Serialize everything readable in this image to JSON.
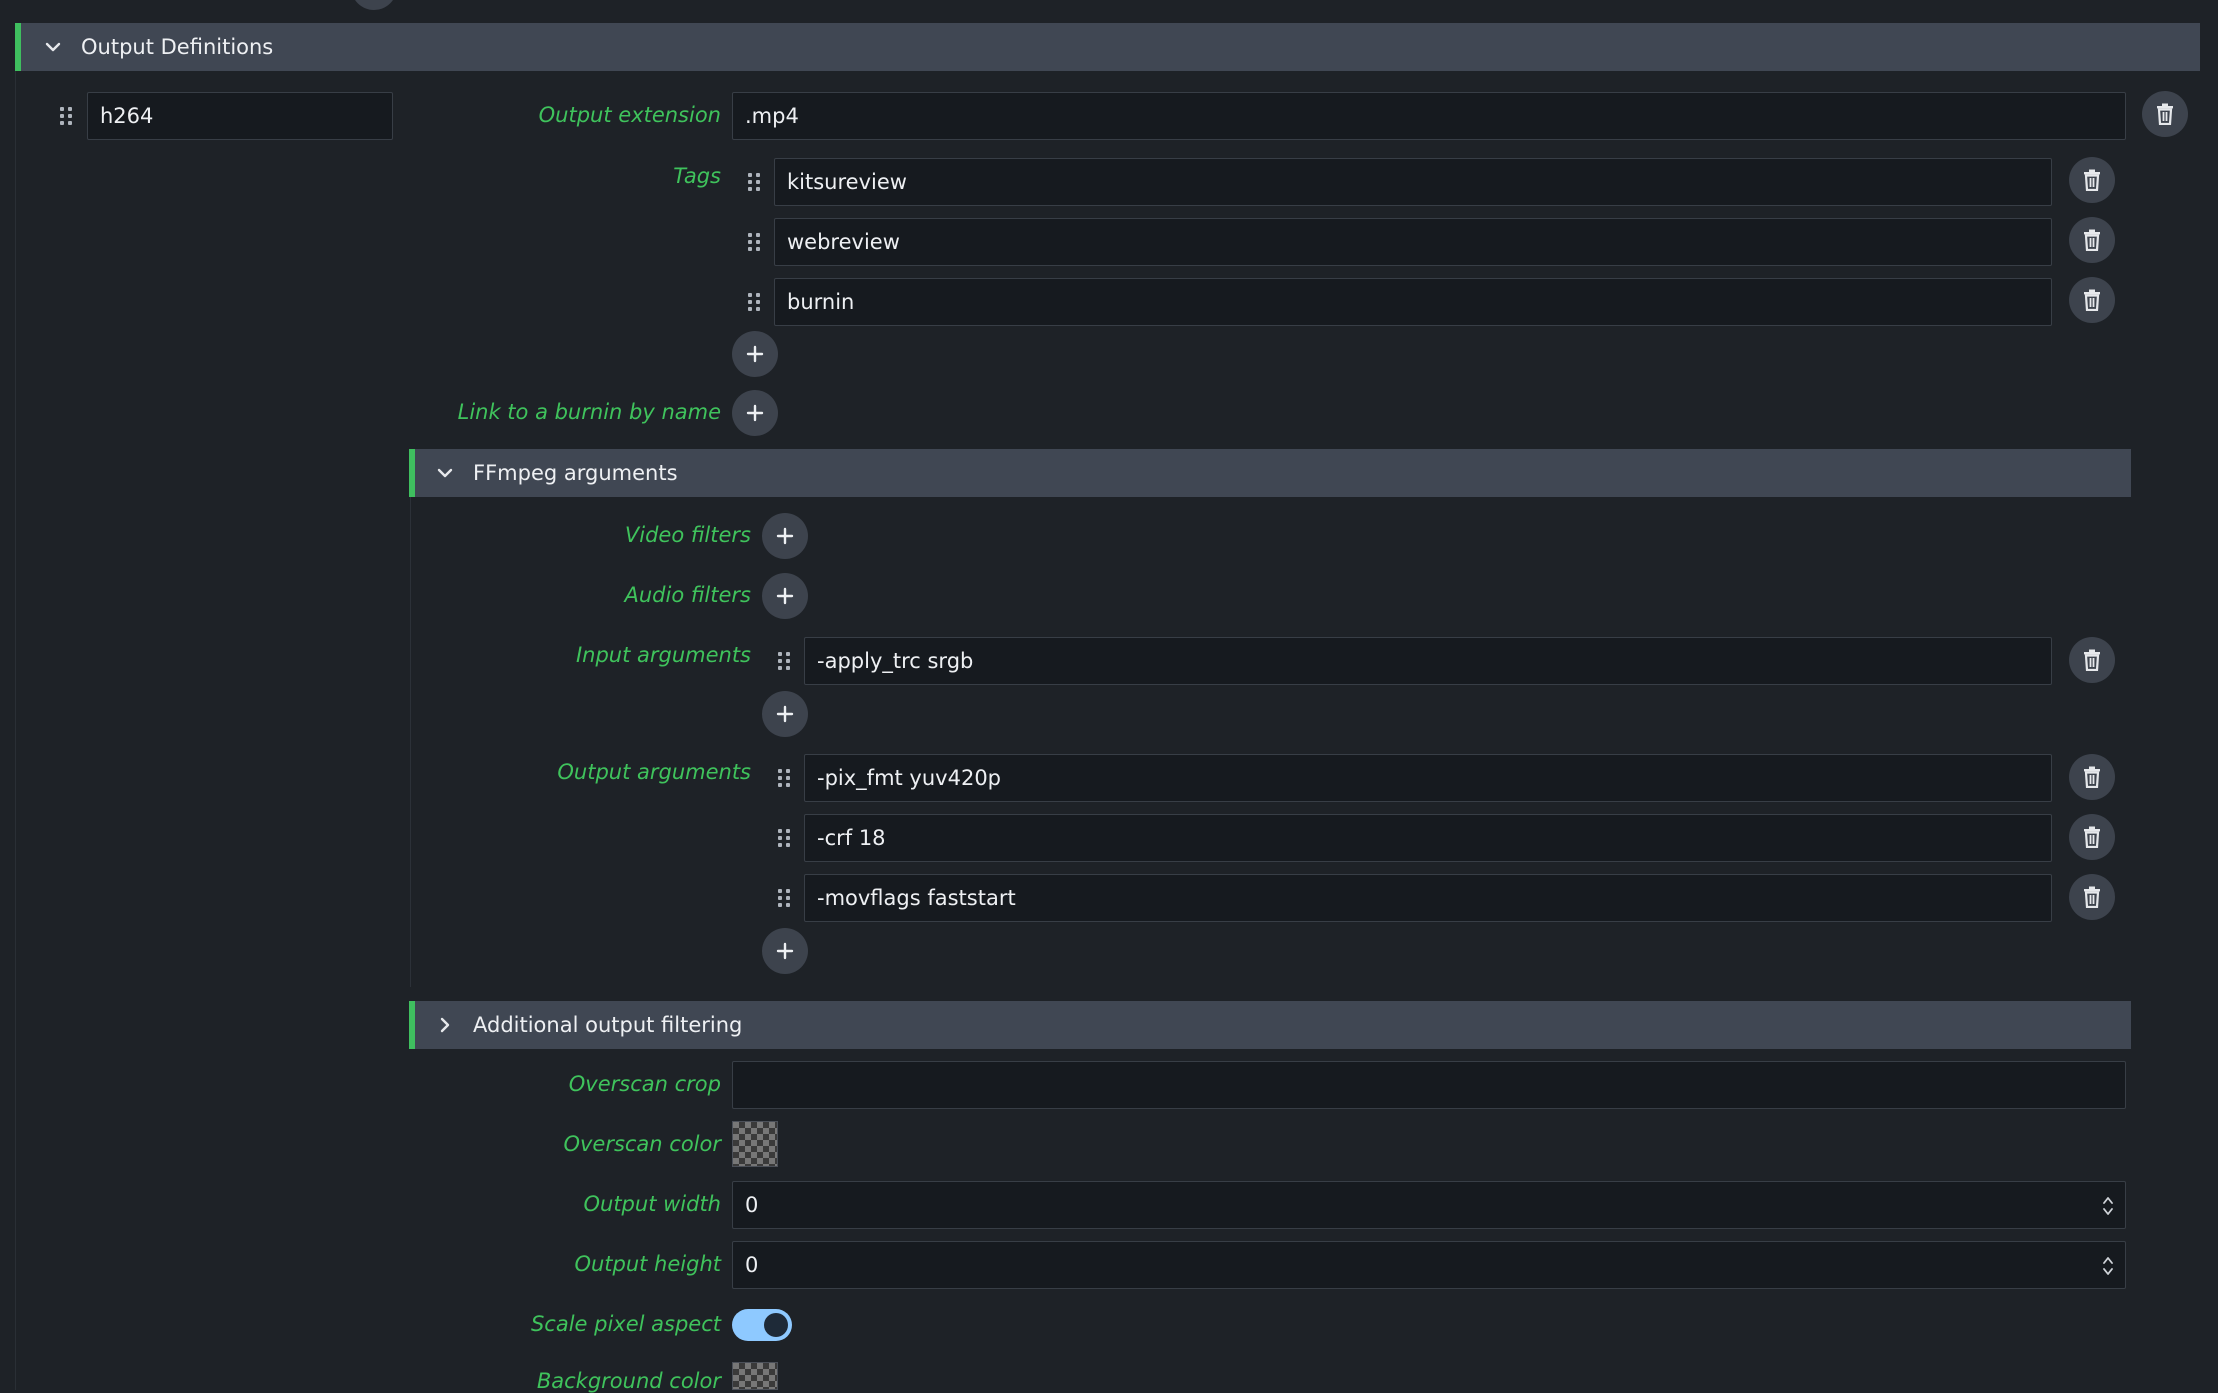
{
  "header": {
    "title": "Output Definitions"
  },
  "output": {
    "name": "h264",
    "extension_label": "Output extension",
    "extension_value": ".mp4",
    "tags_label": "Tags",
    "tags": [
      "kitsureview",
      "webreview",
      "burnin"
    ],
    "burnin_label": "Link to a burnin by name"
  },
  "ffmpeg": {
    "title": "FFmpeg arguments",
    "video_filters_label": "Video filters",
    "audio_filters_label": "Audio filters",
    "input_args_label": "Input arguments",
    "input_args": [
      "-apply_trc srgb"
    ],
    "output_args_label": "Output arguments",
    "output_args": [
      "-pix_fmt yuv420p",
      "-crf 18",
      "-movflags faststart"
    ]
  },
  "filtering": {
    "title": "Additional output filtering"
  },
  "settings": {
    "overscan_crop_label": "Overscan crop",
    "overscan_crop_value": "",
    "overscan_color_label": "Overscan color",
    "output_width_label": "Output width",
    "output_width_value": "0",
    "output_height_label": "Output height",
    "output_height_value": "0",
    "scale_pixel_aspect_label": "Scale pixel aspect",
    "scale_pixel_aspect_enabled": true,
    "background_color_label": "Background color"
  },
  "colors": {
    "accent": "#3fbf5f",
    "toggle_on": "#8ec9ff",
    "header_bg": "#404753"
  }
}
